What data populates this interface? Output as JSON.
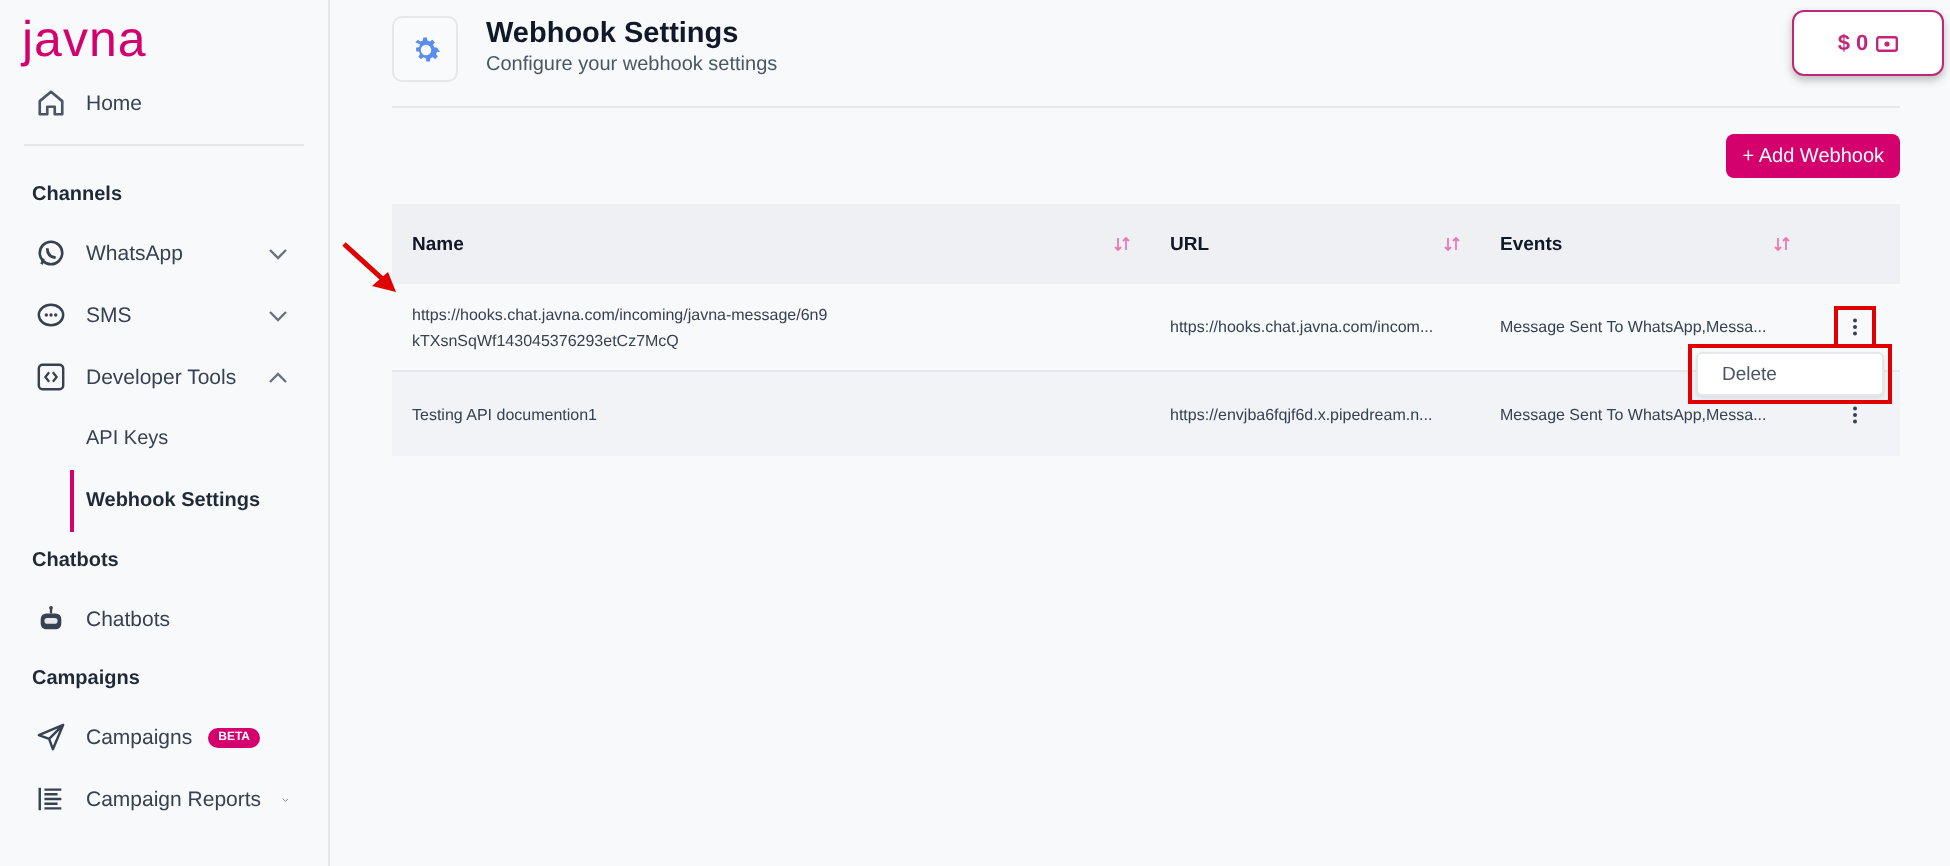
{
  "sidebar": {
    "logo": "javna",
    "items": [
      {
        "kind": "link",
        "label": "Home"
      },
      {
        "kind": "heading",
        "label": "Channels"
      },
      {
        "kind": "group",
        "label": "WhatsApp",
        "expanded": false
      },
      {
        "kind": "group",
        "label": "SMS",
        "expanded": false
      },
      {
        "kind": "group",
        "label": "Developer Tools",
        "expanded": true,
        "children": [
          {
            "label": "API Keys",
            "selected": false
          },
          {
            "label": "Webhook Settings",
            "selected": true
          }
        ]
      },
      {
        "kind": "heading",
        "label": "Chatbots"
      },
      {
        "kind": "link",
        "label": "Chatbots"
      },
      {
        "kind": "heading",
        "label": "Campaigns"
      },
      {
        "kind": "link",
        "label": "Campaigns",
        "badge": "BETA"
      },
      {
        "kind": "group",
        "label": "Campaign Reports",
        "expanded": false
      }
    ]
  },
  "header": {
    "title": "Webhook Settings",
    "subtitle": "Configure your webhook settings"
  },
  "balance": "$ 0",
  "add_button": "+ Add Webhook",
  "table": {
    "columns": [
      {
        "label": "Name",
        "sortable": true
      },
      {
        "label": "URL",
        "sortable": true
      },
      {
        "label": "Events",
        "sortable": true
      }
    ],
    "rows": [
      {
        "name": "https://hooks.chat.javna.com/incoming/javna-message/6n9kTXsnSqWf143045376293etCz7McQ",
        "url": "https://hooks.chat.javna.com/incom...",
        "events": "Message Sent To WhatsApp,Messa...",
        "menu": [
          "Delete"
        ]
      },
      {
        "name": "Testing API documention1",
        "url": "https://envjba6fqjf6d.x.pipedream.n...",
        "events": "Message Sent To WhatsApp,Messa..."
      }
    ]
  }
}
